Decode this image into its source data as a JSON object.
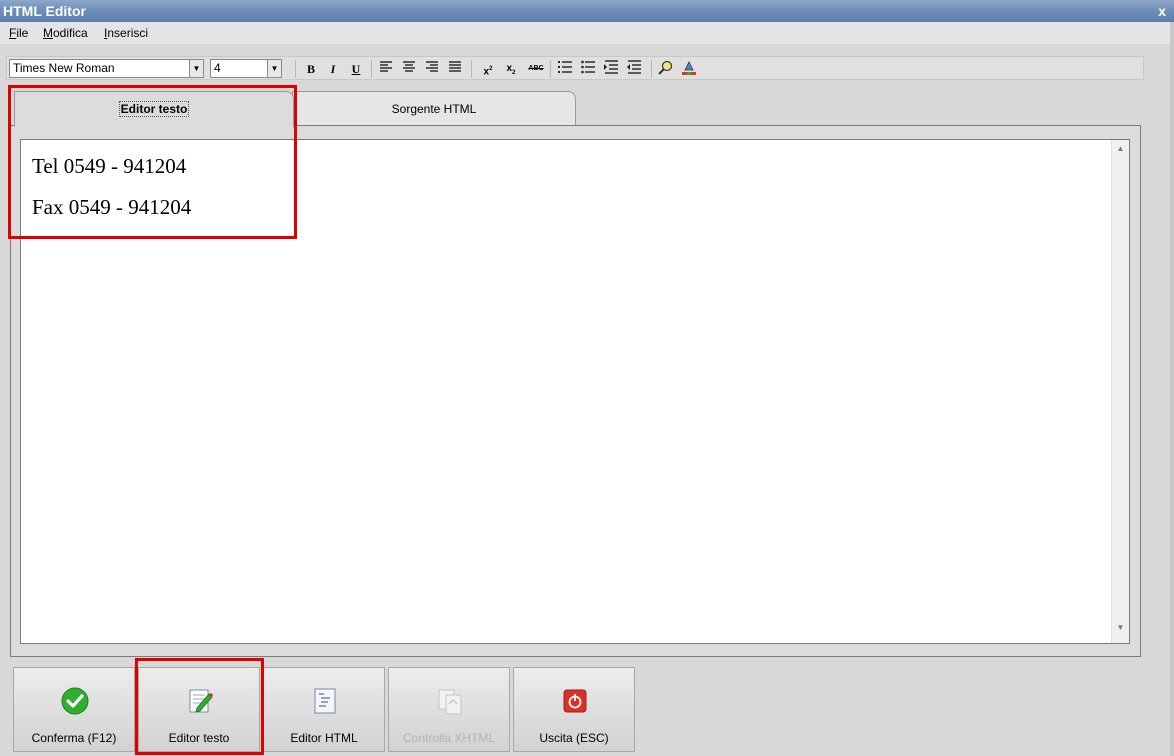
{
  "window": {
    "title": "HTML Editor",
    "close_glyph": "x"
  },
  "menu": {
    "items": [
      "File",
      "Modifica",
      "Inserisci"
    ]
  },
  "toolbar": {
    "font_name": "Times New Roman",
    "font_size": "4",
    "buttons": {
      "bold": "B",
      "italic": "I",
      "underline": "U",
      "strike": "ABC"
    }
  },
  "tabs": [
    {
      "label": "Editor testo",
      "active": true
    },
    {
      "label": "Sorgente HTML",
      "active": false
    }
  ],
  "editor": {
    "lines": [
      "Tel 0549 - 941204",
      "Fax 0549 - 941204"
    ]
  },
  "bottom_buttons": [
    {
      "label": "Conferma (F12)",
      "icon": "check-icon",
      "enabled": true
    },
    {
      "label": "Editor testo",
      "icon": "edit-document-icon",
      "enabled": true
    },
    {
      "label": "Editor HTML",
      "icon": "html-document-icon",
      "enabled": true
    },
    {
      "label": "Controlla XHTML",
      "icon": "validate-document-icon",
      "enabled": false
    },
    {
      "label": "Uscita (ESC)",
      "icon": "power-icon",
      "enabled": true
    }
  ],
  "colors": {
    "highlight": "#e00000",
    "titlebar": "#6f8fb8",
    "check": "#2fae2f",
    "exit": "#d9302a"
  }
}
